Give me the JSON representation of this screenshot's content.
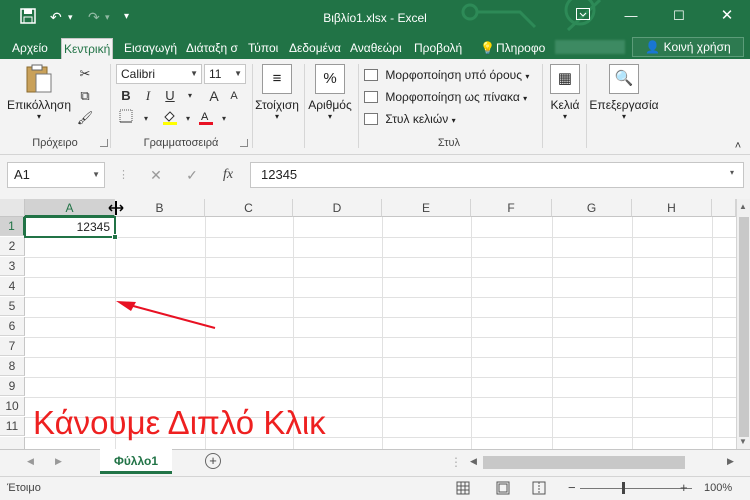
{
  "window": {
    "title": "Βιβλίο1.xlsx - Excel",
    "save_icon": "floppy-disk-icon",
    "undo_icon": "undo-icon",
    "redo_icon": "redo-icon",
    "customize_icon": "chevron-down-icon",
    "ribbon_options_icon": "ribbon-display-icon",
    "minimize_icon": "minimize-icon",
    "maximize_icon": "maximize-icon",
    "close_icon": "close-icon"
  },
  "tabs": [
    {
      "label": "Αρχείο"
    },
    {
      "label": "Κεντρική",
      "active": true
    },
    {
      "label": "Εισαγωγή"
    },
    {
      "label": "Διάταξη σ"
    },
    {
      "label": "Τύποι"
    },
    {
      "label": "Δεδομένα"
    },
    {
      "label": "Αναθεώρι"
    },
    {
      "label": "Προβολή"
    },
    {
      "label": "Πληροφο"
    }
  ],
  "share_label": "Κοινή χρήση",
  "ribbon": {
    "clipboard": {
      "paste_label": "Επικόλληση",
      "group_label": "Πρόχειρο"
    },
    "font": {
      "name": "Calibri",
      "size": "11",
      "bold": "B",
      "italic": "I",
      "underline": "U",
      "grow": "A",
      "shrink": "A",
      "group_label": "Γραμματοσειρά",
      "highlight_color": "#ffff00",
      "font_color": "#e81123"
    },
    "alignment": {
      "label": "Στοίχιση"
    },
    "number": {
      "label": "Αριθμός",
      "icon_text": "%"
    },
    "styles": {
      "conditional": "Μορφοποίηση υπό όρους",
      "as_table": "Μορφοποίηση ως πίνακα",
      "cell_styles": "Στυλ κελιών",
      "group_label": "Στυλ"
    },
    "cells": {
      "label": "Κελιά"
    },
    "editing": {
      "label": "Επεξεργασία"
    }
  },
  "formula_bar": {
    "name_box": "A1",
    "cancel": "✕",
    "enter": "✓",
    "fx": "fx",
    "value": "12345"
  },
  "grid": {
    "columns": [
      "A",
      "B",
      "C",
      "D",
      "E",
      "F",
      "G",
      "H"
    ],
    "rows": [
      "1",
      "2",
      "3",
      "4",
      "5",
      "6",
      "7",
      "8",
      "9",
      "10",
      "11"
    ],
    "active_cell_value": "12345"
  },
  "annotation": "Κάνουμε Διπλό Κλικ",
  "annotation_color": "#ee2020",
  "sheet": {
    "tab_label": "Φύλλο1",
    "add_label": "+"
  },
  "status": {
    "ready": "Έτοιμο",
    "zoom": "100%"
  },
  "accent_color": "#217346"
}
